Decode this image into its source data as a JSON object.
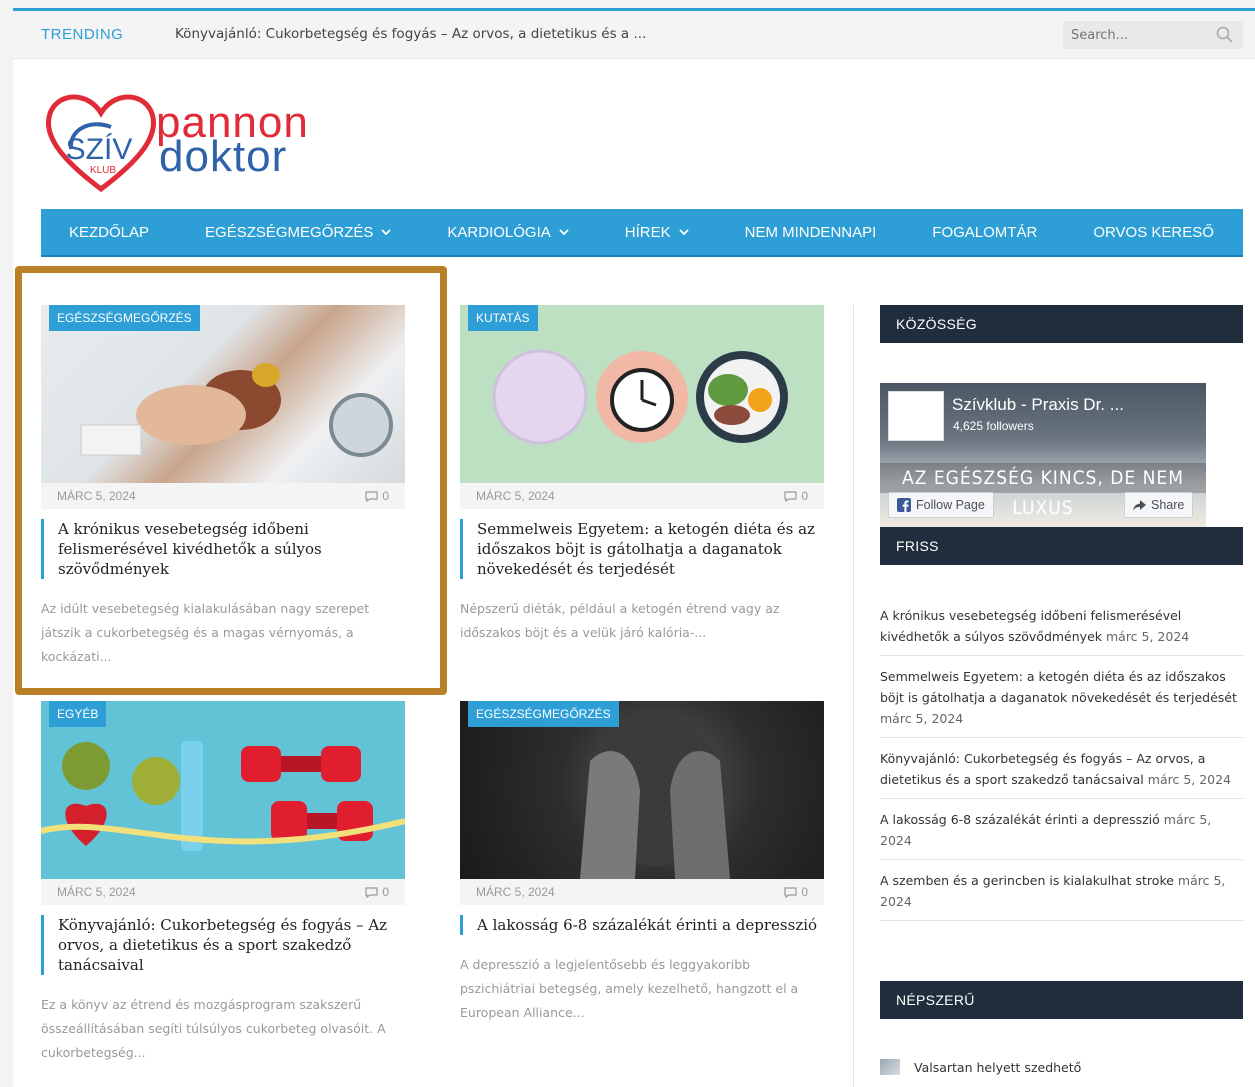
{
  "topbar": {
    "trending_label": "TRENDING",
    "trending_text": "Könyvajánló: Cukorbetegség és fogyás – Az orvos, a dietetikus és a ...",
    "search_placeholder": "Search..."
  },
  "logo": {
    "word1": "pannon",
    "word2": "doktor",
    "badge": "SZÍV",
    "badge_sub": "KLUB"
  },
  "nav": {
    "items": [
      {
        "label": "KEZDŐLAP",
        "dropdown": false
      },
      {
        "label": "EGÉSZSÉGMEGŐRZÉS",
        "dropdown": true
      },
      {
        "label": "KARDIOLÓGIA",
        "dropdown": true
      },
      {
        "label": "HÍREK",
        "dropdown": true
      },
      {
        "label": "NEM MINDENNAPI",
        "dropdown": false
      },
      {
        "label": "FOGALOMTÁR",
        "dropdown": false
      },
      {
        "label": "ORVOS KERESŐ",
        "dropdown": false
      }
    ]
  },
  "articles": [
    {
      "category": "EGÉSZSÉGMEGŐRZÉS",
      "date": "MÁRC 5, 2024",
      "comments": "0",
      "title": "A krónikus vesebetegség időbeni felismerésével kivédhetők a súlyos szövődmények",
      "excerpt": "Az idült vesebetegség kialakulásában nagy szerepet játszik a cukorbetegség és a magas vérnyomás, a kockázati..."
    },
    {
      "category": "KUTATÁS",
      "date": "MÁRC 5, 2024",
      "comments": "0",
      "title": "Semmelweis Egyetem: a ketogén diéta és az időszakos böjt is gátolhatja a daganatok növekedését és terjedését",
      "excerpt": "Népszerű diéták, például a ketogén étrend vagy az időszakos böjt és a velük járó kalória-..."
    },
    {
      "category": "EGYÉB",
      "date": "MÁRC 5, 2024",
      "comments": "0",
      "title": "Könyvajánló: Cukorbetegség és fogyás – Az orvos, a dietetikus és a sport szakedző tanácsaival",
      "excerpt": "Ez a könyv az étrend és mozgásprogram szakszerű összeállításában segíti túlsúlyos cukorbeteg olvasóit. A cukorbetegség..."
    },
    {
      "category": "EGÉSZSÉGMEGŐRZÉS",
      "date": "MÁRC 5, 2024",
      "comments": "0",
      "title": "A lakosság 6-8 százalékát érinti a depresszió",
      "excerpt": "A depresszió a legjelentősebb és leggyakoribb pszichiátriai betegség, amely kezelhető, hangzott el a European Alliance..."
    }
  ],
  "sidebar": {
    "community_title": "KÖZÖSSÉG",
    "fb": {
      "page_name": "Szívklub - Praxis Dr. ...",
      "followers": "4,625 followers",
      "banner": "AZ EGÉSZSÉG KINCS, DE NEM LUXUS",
      "follow_label": "Follow Page",
      "share_label": "Share"
    },
    "recent_title": "FRISS",
    "recent": [
      {
        "title": "A krónikus vesebetegség időbeni felismerésével kivédhetők a súlyos szövődmények",
        "date": "márc 5, 2024"
      },
      {
        "title": "Semmelweis Egyetem: a ketogén diéta és az időszakos böjt is gátolhatja a daganatok növekedését és terjedését",
        "date": "márc 5, 2024"
      },
      {
        "title": "Könyvajánló: Cukorbetegség és fogyás – Az orvos, a dietetikus és a sport szakedző tanácsaival",
        "date": "márc 5, 2024"
      },
      {
        "title": "A lakosság 6-8 százalékát érinti a depresszió",
        "date": "márc 5, 2024"
      },
      {
        "title": "A szemben és a gerincben is kialakulhat stroke",
        "date": "márc 5, 2024"
      }
    ],
    "popular_title": "NÉPSZERŰ",
    "popular_first": "Valsartan helyett szedhető"
  },
  "colors": {
    "accent": "#2e9fd6",
    "highlight": "#b98027",
    "widget_head": "#1f2d3d"
  }
}
